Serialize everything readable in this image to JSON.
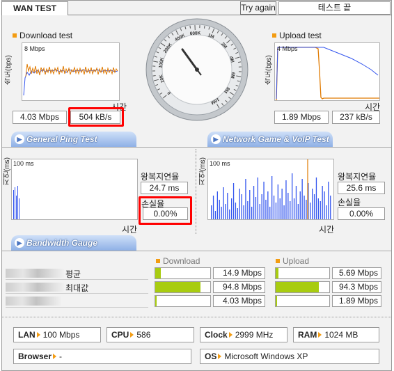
{
  "tab": {
    "label": "WAN TEST"
  },
  "toolbar": {
    "try_again": "Try again",
    "status": "테스트 끝"
  },
  "download": {
    "title": "Download test",
    "ylabel": "속도(bps)",
    "scale": "8 Mbps",
    "xlabel": "시간",
    "mbps": "4.03 Mbps",
    "kbs": "504 kB/s"
  },
  "upload": {
    "title": "Upload test",
    "ylabel": "속도(bps)",
    "scale": "4 Mbps",
    "xlabel": "시간",
    "mbps": "1.89 Mbps",
    "kbs": "237 kB/s"
  },
  "gauge": {
    "ticks": [
      "0",
      "10K",
      "100K",
      "200K",
      "400K",
      "600K",
      "1M",
      "2M",
      "4M",
      "6M",
      "8M",
      "10M"
    ],
    "needle_label": "~"
  },
  "ping_left": {
    "tab": "General Ping Test",
    "ylabel": "지연(ms)",
    "scale": "100 ms",
    "xlabel": "시간",
    "rtt_label": "왕복지연율",
    "rtt_value": "24.7 ms",
    "loss_label": "손실율",
    "loss_value": "0.00%"
  },
  "ping_right": {
    "tab": "Network Game & VoIP Test",
    "ylabel": "지연(ms)",
    "scale": "100 ms",
    "xlabel": "시간",
    "rtt_label": "왕복지연율",
    "rtt_value": "25.6 ms",
    "loss_label": "손실율",
    "loss_value": "0.00%"
  },
  "bandwidth": {
    "tab": "Bandwidth Gauge",
    "download_header": "Download",
    "upload_header": "Upload",
    "rows": [
      {
        "label": "평균",
        "down": "14.9 Mbps",
        "down_level": 0.1,
        "up": "5.69 Mbps",
        "up_level": 0.05
      },
      {
        "label": "최대값",
        "down": "94.8 Mbps",
        "down_level": 0.82,
        "up": "94.3 Mbps",
        "up_level": 0.8
      },
      {
        "label": "",
        "down": "4.03 Mbps",
        "down_level": 0.03,
        "up": "1.89 Mbps",
        "up_level": 0.02
      }
    ]
  },
  "system": {
    "lan_label": "LAN",
    "lan_value": "100 Mbps",
    "cpu_label": "CPU",
    "cpu_value": "586",
    "clock_label": "Clock",
    "clock_value": "2999 MHz",
    "ram_label": "RAM",
    "ram_value": "1024 MB",
    "browser_label": "Browser",
    "browser_value": "-",
    "os_label": "OS",
    "os_value": "Microsoft Windows XP"
  },
  "colors": {
    "accent_orange": "#f39c12",
    "bar_green": "#a8cc10",
    "ping_blue": "#3355ee",
    "highlight_red": "#ff0000"
  }
}
